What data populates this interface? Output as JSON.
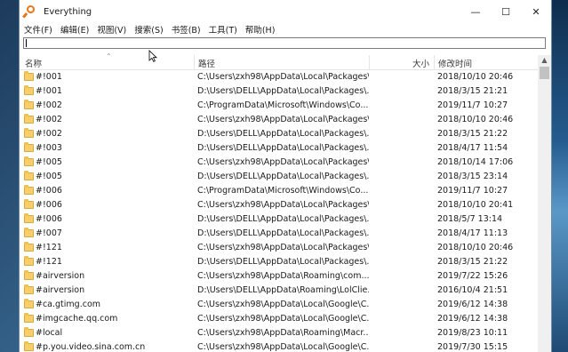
{
  "window": {
    "title": "Everything"
  },
  "controls": {
    "minimize": "—",
    "maximize": "☐",
    "close": "✕"
  },
  "menu": [
    "文件(F)",
    "编辑(E)",
    "视图(V)",
    "搜索(S)",
    "书签(B)",
    "工具(T)",
    "帮助(H)"
  ],
  "search": {
    "value": "",
    "placeholder": ""
  },
  "columns": {
    "name": "名称",
    "path": "路径",
    "size": "大小",
    "date": "修改时间"
  },
  "icons": {
    "app": "everything-magnifier-icon",
    "folder": "folder-icon",
    "sort": "sort-ascending-icon",
    "cursor": "mouse-pointer-icon"
  },
  "colors": {
    "accent": "#e8751a",
    "folder": "#f7d06b"
  },
  "rows": [
    {
      "name": "#!001",
      "path": "C:\\Users\\zxh98\\AppData\\Local\\Packages\\...",
      "size": "",
      "date": "2018/10/10 20:46"
    },
    {
      "name": "#!001",
      "path": "D:\\Users\\DELL\\AppData\\Local\\Packages\\...",
      "size": "",
      "date": "2018/3/15 21:21"
    },
    {
      "name": "#!002",
      "path": "C:\\ProgramData\\Microsoft\\Windows\\Co...",
      "size": "",
      "date": "2019/11/7 10:27"
    },
    {
      "name": "#!002",
      "path": "C:\\Users\\zxh98\\AppData\\Local\\Packages\\...",
      "size": "",
      "date": "2018/10/10 20:46"
    },
    {
      "name": "#!002",
      "path": "D:\\Users\\DELL\\AppData\\Local\\Packages\\...",
      "size": "",
      "date": "2018/3/15 21:22"
    },
    {
      "name": "#!003",
      "path": "D:\\Users\\DELL\\AppData\\Local\\Packages\\...",
      "size": "",
      "date": "2018/4/17 11:54"
    },
    {
      "name": "#!005",
      "path": "C:\\Users\\zxh98\\AppData\\Local\\Packages\\...",
      "size": "",
      "date": "2018/10/14 17:06"
    },
    {
      "name": "#!005",
      "path": "D:\\Users\\DELL\\AppData\\Local\\Packages\\...",
      "size": "",
      "date": "2018/3/15 23:14"
    },
    {
      "name": "#!006",
      "path": "C:\\ProgramData\\Microsoft\\Windows\\Co...",
      "size": "",
      "date": "2019/11/7 10:27"
    },
    {
      "name": "#!006",
      "path": "C:\\Users\\zxh98\\AppData\\Local\\Packages\\...",
      "size": "",
      "date": "2018/10/10 20:41"
    },
    {
      "name": "#!006",
      "path": "D:\\Users\\DELL\\AppData\\Local\\Packages\\...",
      "size": "",
      "date": "2018/5/7 13:14"
    },
    {
      "name": "#!007",
      "path": "D:\\Users\\DELL\\AppData\\Local\\Packages\\...",
      "size": "",
      "date": "2018/4/17 11:13"
    },
    {
      "name": "#!121",
      "path": "C:\\Users\\zxh98\\AppData\\Local\\Packages\\...",
      "size": "",
      "date": "2018/10/10 20:46"
    },
    {
      "name": "#!121",
      "path": "D:\\Users\\DELL\\AppData\\Local\\Packages\\...",
      "size": "",
      "date": "2018/3/15 21:22"
    },
    {
      "name": "#airversion",
      "path": "C:\\Users\\zxh98\\AppData\\Roaming\\com....",
      "size": "",
      "date": "2019/7/22 15:26"
    },
    {
      "name": "#airversion",
      "path": "D:\\Users\\DELL\\AppData\\Roaming\\LolClie...",
      "size": "",
      "date": "2016/10/4 21:51"
    },
    {
      "name": "#ca.gtimg.com",
      "path": "C:\\Users\\zxh98\\AppData\\Local\\Google\\C...",
      "size": "",
      "date": "2019/6/12 14:38"
    },
    {
      "name": "#imgcache.qq.com",
      "path": "C:\\Users\\zxh98\\AppData\\Local\\Google\\C...",
      "size": "",
      "date": "2019/6/12 14:38"
    },
    {
      "name": "#local",
      "path": "C:\\Users\\zxh98\\AppData\\Roaming\\Macr...",
      "size": "",
      "date": "2019/8/23 10:11"
    },
    {
      "name": "#p.you.video.sina.com.cn",
      "path": "C:\\Users\\zxh98\\AppData\\Local\\Google\\C...",
      "size": "",
      "date": "2019/7/30 15:15"
    }
  ]
}
